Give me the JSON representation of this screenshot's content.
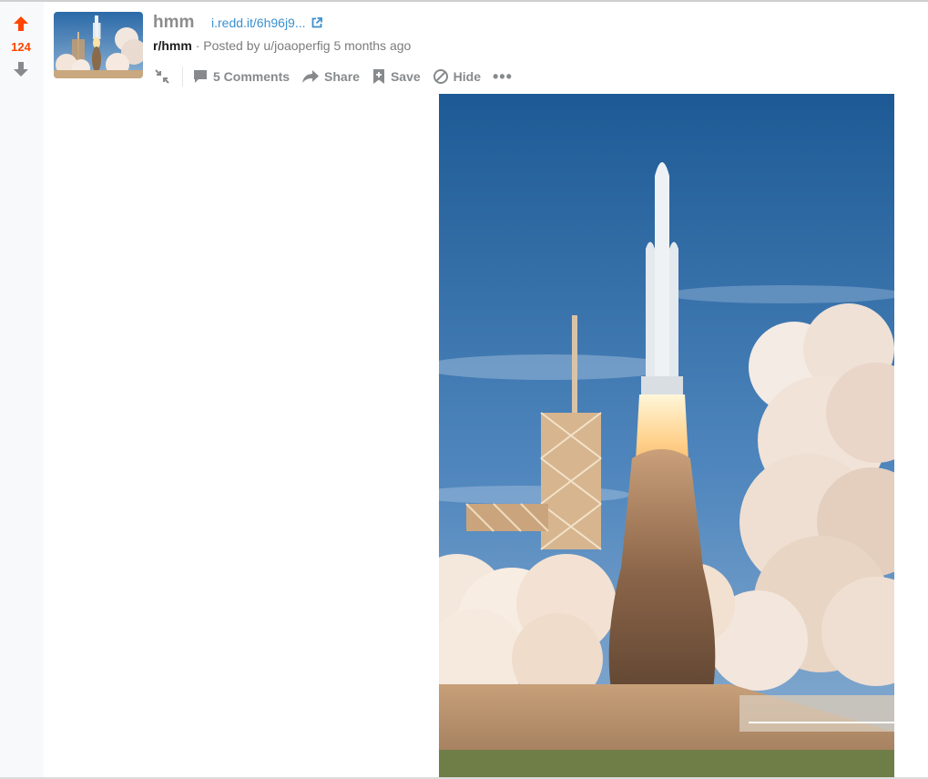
{
  "post": {
    "score": "124",
    "title": "hmm",
    "domain": "i.redd.it/6h96j9...",
    "subreddit": "r/hmm",
    "posted_by_prefix": "· Posted by",
    "author": "u/joaoperfig",
    "age": "5 months ago"
  },
  "actions": {
    "comments_label": "5 Comments",
    "share_label": "Share",
    "save_label": "Save",
    "hide_label": "Hide",
    "more_label": "•••"
  },
  "colors": {
    "upvote_active": "#ff4500",
    "vote_inactive": "#878a8c",
    "link_blue": "#3a91d1",
    "sky_top": "#1d5a95",
    "sky_bottom": "#6f9fc8"
  },
  "icons": [
    "arrow-up-icon",
    "arrow-down-icon",
    "external-link-icon",
    "collapse-icon",
    "comment-icon",
    "share-icon",
    "save-icon",
    "hide-icon",
    "more-icon"
  ]
}
